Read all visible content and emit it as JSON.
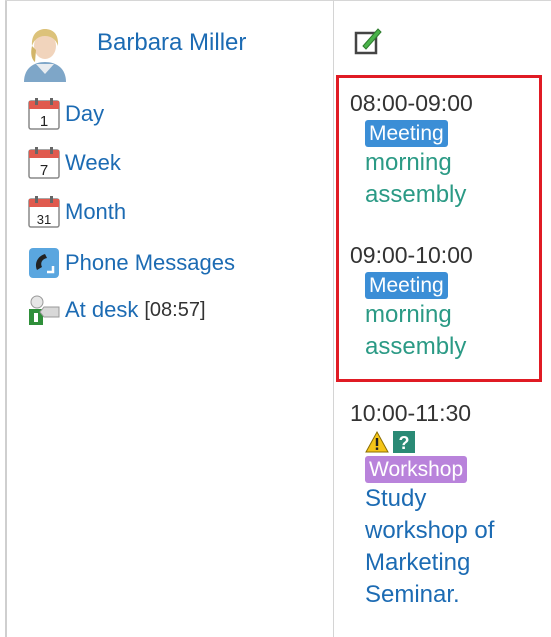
{
  "user": {
    "name": "Barbara Miller"
  },
  "nav": [
    {
      "id": "day",
      "label": "Day",
      "icon": "calendar-day-icon",
      "icon_number": "1"
    },
    {
      "id": "week",
      "label": "Week",
      "icon": "calendar-week-icon",
      "icon_number": "7"
    },
    {
      "id": "month",
      "label": "Month",
      "icon": "calendar-month-icon",
      "icon_number": "31"
    },
    {
      "id": "phone",
      "label": "Phone Messages",
      "icon": "phone-icon"
    }
  ],
  "presence": {
    "label": "At desk",
    "time": "[08:57]",
    "icon": "presence-at-desk-icon"
  },
  "events": [
    {
      "time": "08:00-09:00",
      "badge": "Meeting",
      "title_lines": [
        "morning",
        "assembly"
      ]
    },
    {
      "time": "09:00-10:00",
      "badge": "Meeting",
      "title_lines": [
        "morning",
        "assembly"
      ]
    },
    {
      "time": "10:00-11:30",
      "flags": [
        "warning-icon",
        "question-icon"
      ],
      "badge": "Workshop",
      "title_lines": [
        "Study",
        "workshop of",
        "Marketing",
        "Seminar."
      ]
    }
  ],
  "colors": {
    "link": "#1c6bb3",
    "meeting_badge": "#3b8ed6",
    "workshop_badge": "#b983db",
    "event_title_green": "#2b9a85",
    "highlight_border": "#e01b24"
  }
}
